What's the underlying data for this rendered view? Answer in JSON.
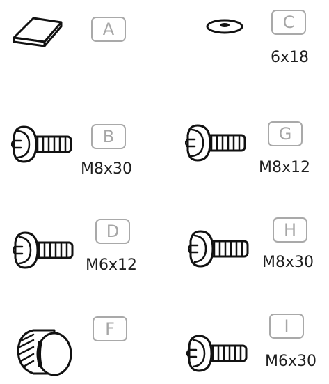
{
  "parts": {
    "A": {
      "letter": "A",
      "size": ""
    },
    "B": {
      "letter": "B",
      "size": "M8x30"
    },
    "C": {
      "letter": "C",
      "size": "6x18"
    },
    "D": {
      "letter": "D",
      "size": "M6x12"
    },
    "F": {
      "letter": "F",
      "size": ""
    },
    "G": {
      "letter": "G",
      "size": "M8x12"
    },
    "H": {
      "letter": "H",
      "size": "M8x30"
    },
    "I": {
      "letter": "I",
      "size": "M6x30"
    }
  },
  "icons": {
    "A": "adhesive-pad-icon",
    "B": "screw-icon",
    "C": "washer-icon",
    "D": "screw-icon",
    "F": "end-cap-icon",
    "G": "screw-icon",
    "H": "screw-icon",
    "I": "screw-icon"
  }
}
